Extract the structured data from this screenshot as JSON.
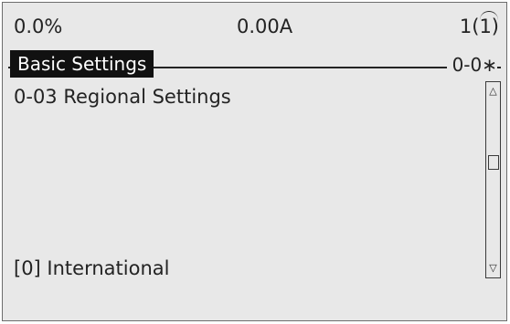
{
  "status": {
    "left_readout": "0.0%",
    "center_readout": "0.00A",
    "right_readout": "1(1)"
  },
  "menu": {
    "title": "Basic Settings",
    "index": "0-0∗"
  },
  "parameter": {
    "name": "0-03 Regional Settings",
    "value": "[0] International"
  },
  "scrollbar": {
    "up_glyph": "△",
    "down_glyph": "▽"
  }
}
